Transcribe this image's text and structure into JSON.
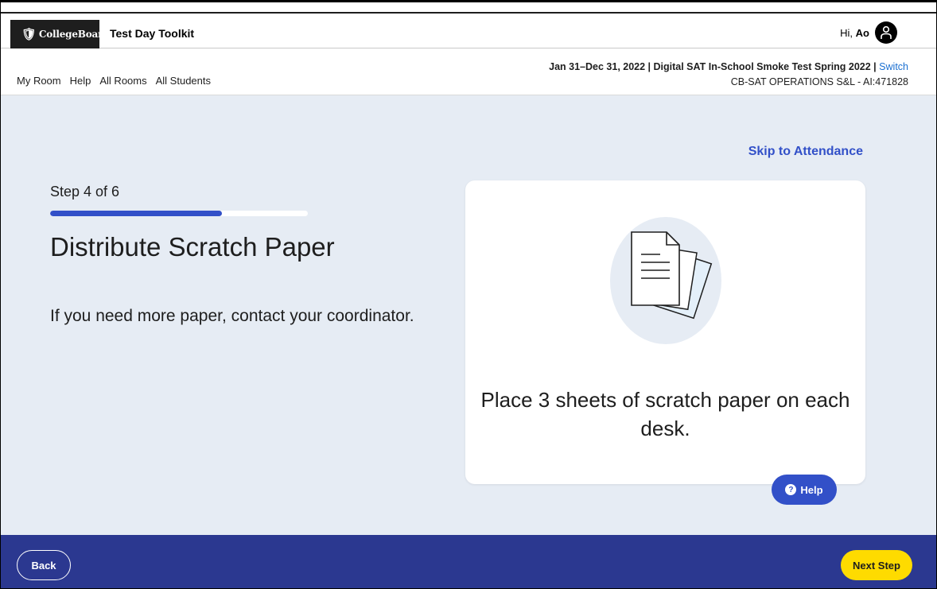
{
  "header": {
    "brand": "CollegeBoard",
    "app_title": "Test Day Toolkit",
    "greeting_prefix": "Hi,",
    "user_name": "Ao"
  },
  "nav": {
    "items": [
      {
        "label": "My Room"
      },
      {
        "label": "Help"
      },
      {
        "label": "All Rooms"
      },
      {
        "label": "All Students"
      }
    ],
    "event_line": "Jan 31–Dec 31, 2022 | Digital SAT In-School Smoke Test Spring 2022 |",
    "switch_label": "Switch",
    "org_line": "CB-SAT OPERATIONS S&L - AI:471828"
  },
  "main": {
    "skip_label": "Skip to Attendance",
    "step_label": "Step 4 of 6",
    "progress_fraction": 0.667,
    "title": "Distribute Scratch Paper",
    "instruction": "If you need more paper, contact your coordinator.",
    "card_text": "Place 3 sheets of scratch paper on each desk.",
    "illustration_icon": "scratch-paper-illustration",
    "help_label": "Help"
  },
  "footer": {
    "back_label": "Back",
    "next_label": "Next Step"
  },
  "colors": {
    "accent": "#3250c8",
    "footer_bg": "#2b3890",
    "next_button": "#fedb00",
    "main_bg": "#e6ecf4"
  }
}
